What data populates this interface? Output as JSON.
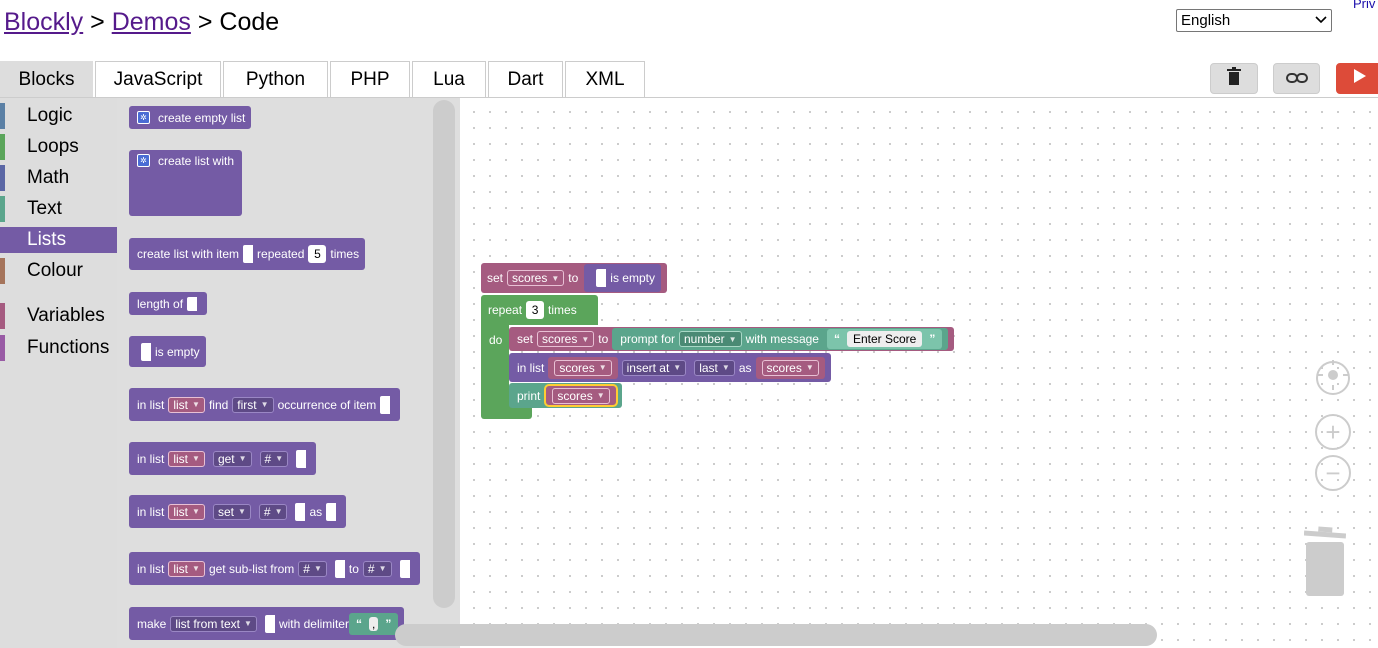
{
  "breadcrumb": {
    "blockly": "Blockly",
    "sep1": ">",
    "demos": "Demos",
    "sep2": ">",
    "current": "Code"
  },
  "privacy": "Priv",
  "language_select": {
    "value": "English"
  },
  "tabs": [
    {
      "label": "Blocks",
      "active": true
    },
    {
      "label": "JavaScript"
    },
    {
      "label": "Python"
    },
    {
      "label": "PHP"
    },
    {
      "label": "Lua"
    },
    {
      "label": "Dart"
    },
    {
      "label": "XML"
    }
  ],
  "toolbar_icons": [
    "trash-icon",
    "link-icon",
    "run-icon"
  ],
  "toolbox": {
    "categories": [
      {
        "label": "Logic",
        "color": "#5b80a5"
      },
      {
        "label": "Loops",
        "color": "#5ba55b"
      },
      {
        "label": "Math",
        "color": "#5b67a5"
      },
      {
        "label": "Text",
        "color": "#5ba58c"
      },
      {
        "label": "Lists",
        "color": "#745ba5",
        "selected": true
      },
      {
        "label": "Colour",
        "color": "#a5745b"
      },
      {
        "label": "Variables",
        "color": "#a55b80"
      },
      {
        "label": "Functions",
        "color": "#995ba5"
      }
    ]
  },
  "flyout": {
    "create_empty": "create empty list",
    "create_with": "create list with",
    "repeat_item": "create list with item",
    "repeated": "repeated",
    "repeat_num": "5",
    "times": "times",
    "length_of": "length of",
    "is_empty": "is empty",
    "in_list": "in list",
    "list_var": "list",
    "find": "find",
    "first": "first",
    "occurrence": "occurrence of item",
    "get": "get",
    "hash": "#",
    "set": "set",
    "as": "as",
    "sublist": "get sub-list from",
    "to": "to",
    "make": "make",
    "list_from_text": "list from text",
    "with_delimiter": "with delimiter",
    "delimiter_value": ","
  },
  "workspace": {
    "set": "set",
    "scores": "scores",
    "to": "to",
    "is_empty": "is empty",
    "repeat": "repeat",
    "repeat_num": "3",
    "times": "times",
    "do": "do",
    "prompt_for": "prompt for",
    "number": "number",
    "with_message": "with message",
    "enter_score": "Enter Score",
    "in_list": "in list",
    "insert_at": "insert at",
    "last": "last",
    "as": "as",
    "print": "print"
  },
  "colors": {
    "lists": "#745ba5",
    "variables": "#a55b80",
    "loops": "#5ba55b",
    "text": "#5ba58c",
    "run": "#dd4b39"
  }
}
